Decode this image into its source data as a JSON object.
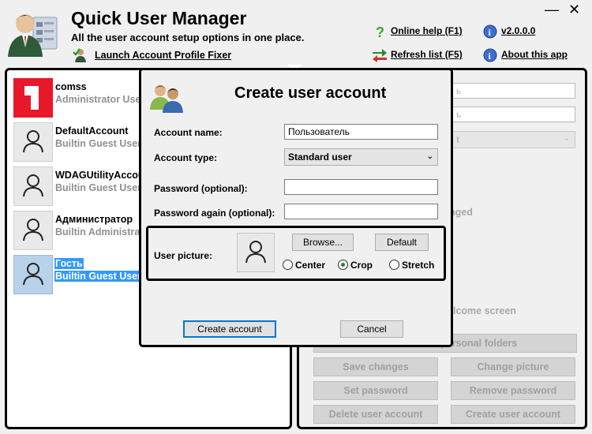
{
  "app": {
    "title": "Quick User Manager",
    "subtitle": "All the user account setup options in one place.",
    "launch_fixer": "Launch Account Profile Fixer"
  },
  "header_links": {
    "online_help": "Online help (F1)",
    "version": "v2.0.0.0",
    "refresh": "Refresh list (F5)",
    "about": "About this app"
  },
  "window": {
    "minimize": "—",
    "close": "✕"
  },
  "users": [
    {
      "name": "comss",
      "type": "Administrator User",
      "avatar": "red-logo"
    },
    {
      "name": "DefaultAccount",
      "type": "Builtin Guest User",
      "avatar": "person-icon"
    },
    {
      "name": "WDAGUtilityAccount",
      "type": "Builtin Guest User",
      "avatar": "person-icon"
    },
    {
      "name": "Администратор",
      "type": "Builtin Administrator",
      "avatar": "person-icon"
    },
    {
      "name": "Гость",
      "type": "Builtin Guest User",
      "avatar": "person-icon",
      "selected": true
    }
  ],
  "right_panel": {
    "input1_partial": "ь",
    "input2_partial": "ь",
    "select_partial": "t",
    "changed_partial": "nged",
    "welcome_partial": "lcome screen",
    "personal_folders_partial": "personal folders",
    "buttons": {
      "save_changes": "Save changes",
      "change_picture": "Change picture",
      "set_password": "Set password",
      "remove_password": "Remove password",
      "delete_account": "Delete user account",
      "create_account": "Create user account"
    }
  },
  "dialog": {
    "title": "Create user account",
    "account_name_label": "Account name:",
    "account_name_value": "Пользователь",
    "account_type_label": "Account type:",
    "account_type_value": "Standard user",
    "password_label": "Password (optional):",
    "password_value": "",
    "password_again_label": "Password again (optional):",
    "password_again_value": "",
    "user_picture_label": "User picture:",
    "browse_button": "Browse...",
    "default_button": "Default",
    "radio_options": [
      "Center",
      "Crop",
      "Stretch"
    ],
    "radio_selected": "Crop",
    "create_button": "Create account",
    "cancel_button": "Cancel"
  },
  "colors": {
    "selection": "#3399ff",
    "brand_red": "#e8182a",
    "focus_blue": "#0078d7"
  }
}
